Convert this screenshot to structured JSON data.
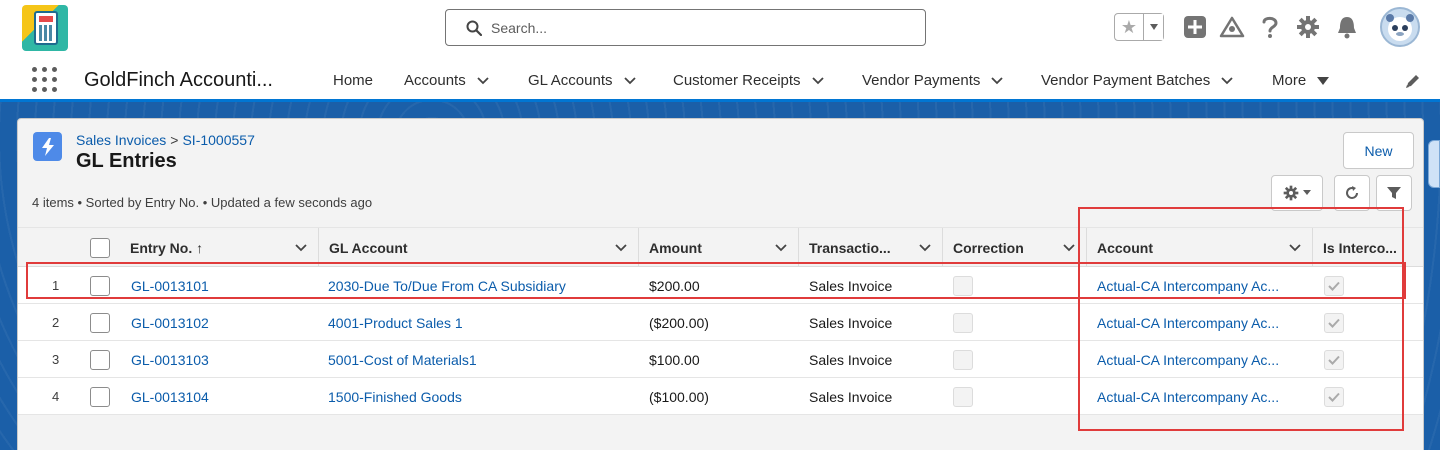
{
  "header": {
    "search_placeholder": "Search..."
  },
  "nav": {
    "app_name": "GoldFinch Accounti...",
    "items": [
      {
        "label": "Home"
      },
      {
        "label": "Accounts"
      },
      {
        "label": "GL Accounts"
      },
      {
        "label": "Customer Receipts"
      },
      {
        "label": "Vendor Payments"
      },
      {
        "label": "Vendor Payment Batches"
      },
      {
        "label": "More"
      }
    ]
  },
  "breadcrumb": {
    "parent": "Sales Invoices",
    "separator": ">",
    "record": "SI-1000557"
  },
  "page": {
    "title": "GL Entries",
    "new_button": "New",
    "meta": "4 items • Sorted by Entry No. • Updated a few seconds ago"
  },
  "table": {
    "columns": {
      "entry_no": "Entry No. ↑",
      "gl_account": "GL Account",
      "amount": "Amount",
      "transaction": "Transactio...",
      "correction": "Correction",
      "account": "Account",
      "is_interco": "Is Interco..."
    },
    "rows": [
      {
        "num": "1",
        "entry_no": "GL-0013101",
        "gl_account": "2030-Due To/Due From CA Subsidiary",
        "amount": "$200.00",
        "transaction": "Sales Invoice",
        "correction": false,
        "account": "Actual-CA Intercompany Ac...",
        "is_interco": true
      },
      {
        "num": "2",
        "entry_no": "GL-0013102",
        "gl_account": "4001-Product Sales 1",
        "amount": "($200.00)",
        "transaction": "Sales Invoice",
        "correction": false,
        "account": "Actual-CA Intercompany Ac...",
        "is_interco": true
      },
      {
        "num": "3",
        "entry_no": "GL-0013103",
        "gl_account": "5001-Cost of Materials1",
        "amount": "$100.00",
        "transaction": "Sales Invoice",
        "correction": false,
        "account": "Actual-CA Intercompany Ac...",
        "is_interco": true
      },
      {
        "num": "4",
        "entry_no": "GL-0013104",
        "gl_account": "1500-Finished Goods",
        "amount": "($100.00)",
        "transaction": "Sales Invoice",
        "correction": false,
        "account": "Actual-CA Intercompany Ac...",
        "is_interco": true
      }
    ]
  },
  "colors": {
    "brand_blue": "#0176d3",
    "link": "#0b5cab",
    "annotation_red": "#e03b3b"
  }
}
